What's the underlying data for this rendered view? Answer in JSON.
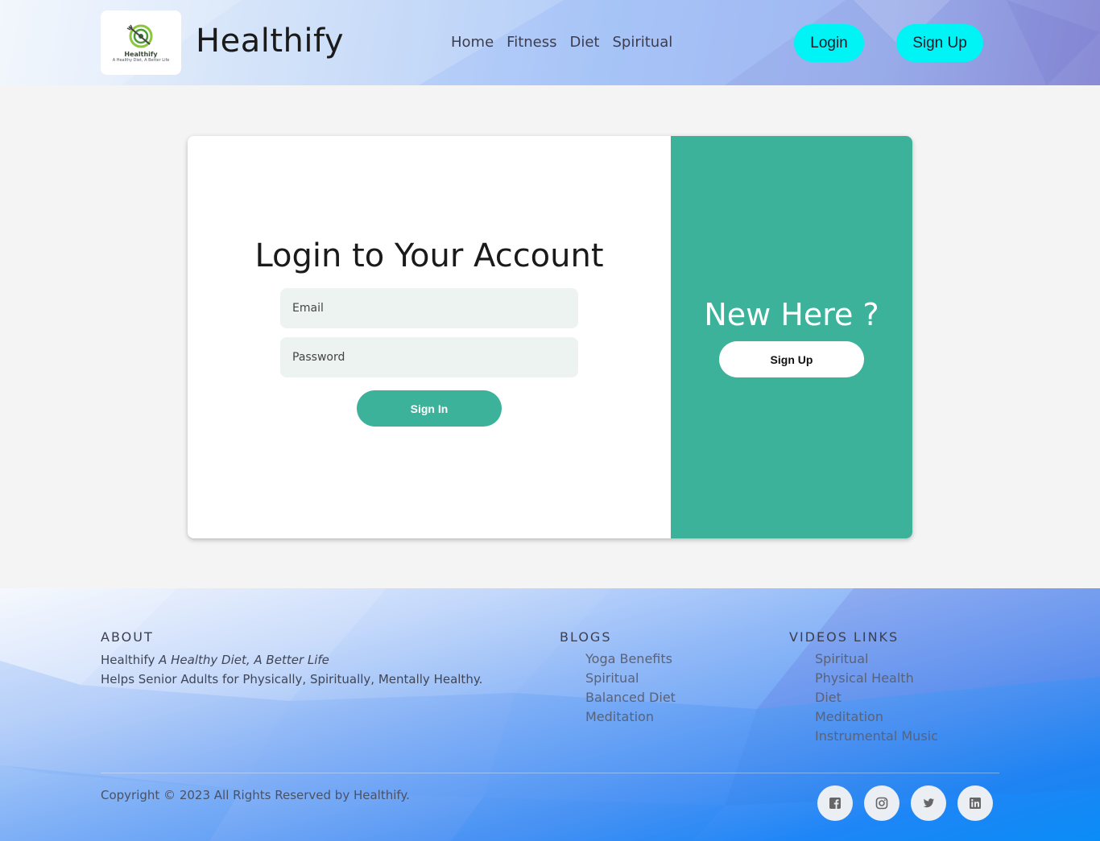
{
  "header": {
    "logo_brand": "Healthify",
    "logo_tagline": "A Healthy Diet, A Better Life",
    "brand_name": "Healthify",
    "nav": [
      "Home",
      "Fitness",
      "Diet",
      "Spiritual"
    ],
    "login_label": "Login",
    "signup_label": "Sign Up",
    "accent_color": "#00f3f5"
  },
  "login_card": {
    "title": "Login to Your Account",
    "email_placeholder": "Email",
    "password_placeholder": "Password",
    "signin_label": "Sign In",
    "new_here_title": "New Here ?",
    "signup_label": "Sign Up",
    "accent_color": "#3cb29b"
  },
  "footer": {
    "about": {
      "heading": "ABOUT",
      "brand": "Healthify",
      "tagline": "A Healthy Diet, A Better Life",
      "description": "Helps Senior Adults for Physically, Spiritually, Mentally Healthy."
    },
    "blogs": {
      "heading": "BLOGS",
      "items": [
        "Yoga Benefits",
        "Spiritual",
        "Balanced Diet",
        "Meditation"
      ]
    },
    "videos": {
      "heading": "VIDEOS LINKS",
      "items": [
        "Spiritual",
        "Physical Health",
        "Diet",
        "Meditation",
        "Instrumental Music"
      ]
    },
    "copyright_prefix": "Copyright © 2023 All Rights Reserved by",
    "copyright_brand": "Healthify.",
    "social_icons": [
      "facebook-icon",
      "instagram-icon",
      "twitter-icon",
      "linkedin-icon"
    ]
  }
}
